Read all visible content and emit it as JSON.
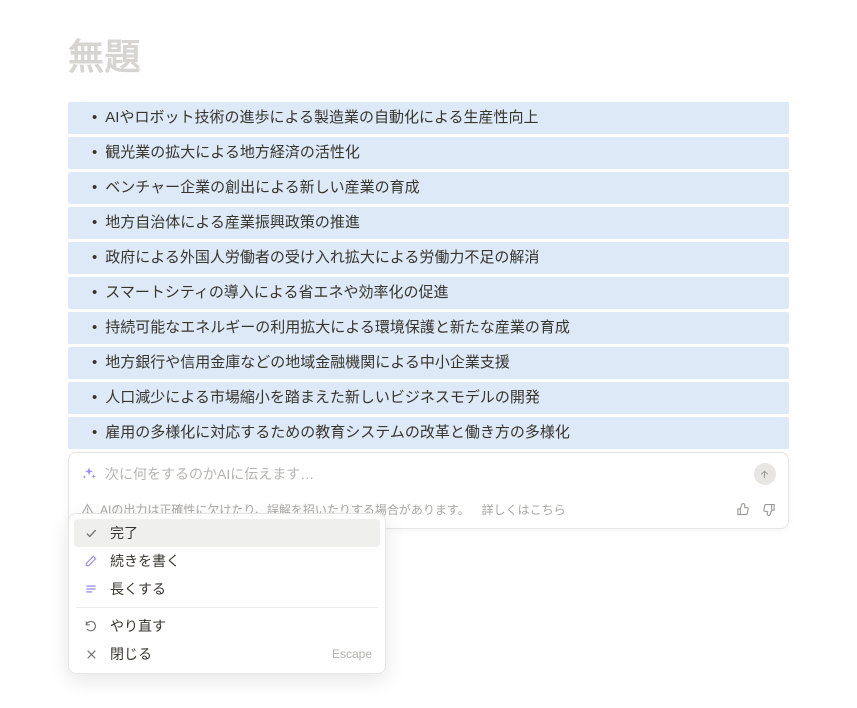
{
  "page": {
    "title": "無題"
  },
  "bullets": [
    "AIやロボット技術の進歩による製造業の自動化による生産性向上",
    "観光業の拡大による地方経済の活性化",
    "ベンチャー企業の創出による新しい産業の育成",
    "地方自治体による産業振興政策の推進",
    "政府による外国人労働者の受け入れ拡大による労働力不足の解消",
    "スマートシティの導入による省エネや効率化の促進",
    "持続可能なエネルギーの利用拡大による環境保護と新たな産業の育成",
    "地方銀行や信用金庫などの地域金融機関による中小企業支援",
    "人口減少による市場縮小を踏まえた新しいビジネスモデルの開発",
    "雇用の多様化に対応するための教育システムの改革と働き方の多様化"
  ],
  "ai": {
    "placeholder": "次に何をするのかAIに伝えます…",
    "disclaimer": "AIの出力は正確性に欠けたり、誤解を招いたりする場合があります。",
    "learn_more": "詳しくはこちら"
  },
  "menu": {
    "done": "完了",
    "continue": "続きを書く",
    "longer": "長くする",
    "retry": "やり直す",
    "close": "閉じる",
    "close_shortcut": "Escape"
  }
}
